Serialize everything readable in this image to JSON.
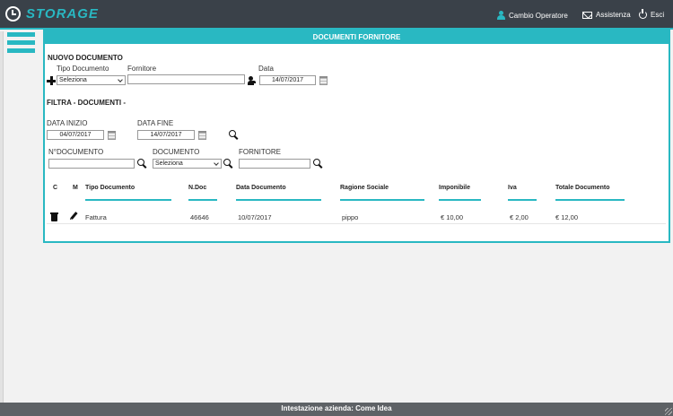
{
  "app": {
    "brand": "STORAGE"
  },
  "topnav": {
    "operator_label": "Cambio Operatore",
    "help_label": "Assistenza",
    "exit_label": "Esci"
  },
  "panel": {
    "title": "DOCUMENTI FORNITORE"
  },
  "new_document": {
    "section_title": "NUOVO DOCUMENTO",
    "tipo_label": "Tipo Documento",
    "tipo_value": "Seleziona",
    "fornitore_label": "Fornitore",
    "fornitore_value": "",
    "data_label": "Data",
    "data_value": "14/07/2017"
  },
  "filter": {
    "section_title": "FILTRA - DOCUMENTI -",
    "data_inizio_label": "DATA INIZIO",
    "data_inizio_value": "04/07/2017",
    "data_fine_label": "DATA FINE",
    "data_fine_value": "14/07/2017",
    "ndoc_label": "N°DOCUMENTO",
    "ndoc_value": "",
    "documento_label": "DOCUMENTO",
    "documento_value": "Seleziona",
    "fornitore_label": "FORNITORE",
    "fornitore_value": ""
  },
  "table": {
    "headers": [
      "C",
      "M",
      "Tipo Documento",
      "N.Doc",
      "Data Documento",
      "Ragione Sociale",
      "Imponibile",
      "Iva",
      "Totale Documento"
    ],
    "rows": [
      {
        "tipo": "Fattura",
        "ndoc": "46646",
        "data": "10/07/2017",
        "ragione": "pippo",
        "imponibile": "€ 10,00",
        "iva": "€ 2,00",
        "totale": "€ 12,00"
      }
    ]
  },
  "footer": {
    "text": "Intestazione azienda: Come Idea"
  },
  "colors": {
    "accent": "#29b8c2",
    "topbar": "#3a4149",
    "footer": "#5e6266"
  }
}
